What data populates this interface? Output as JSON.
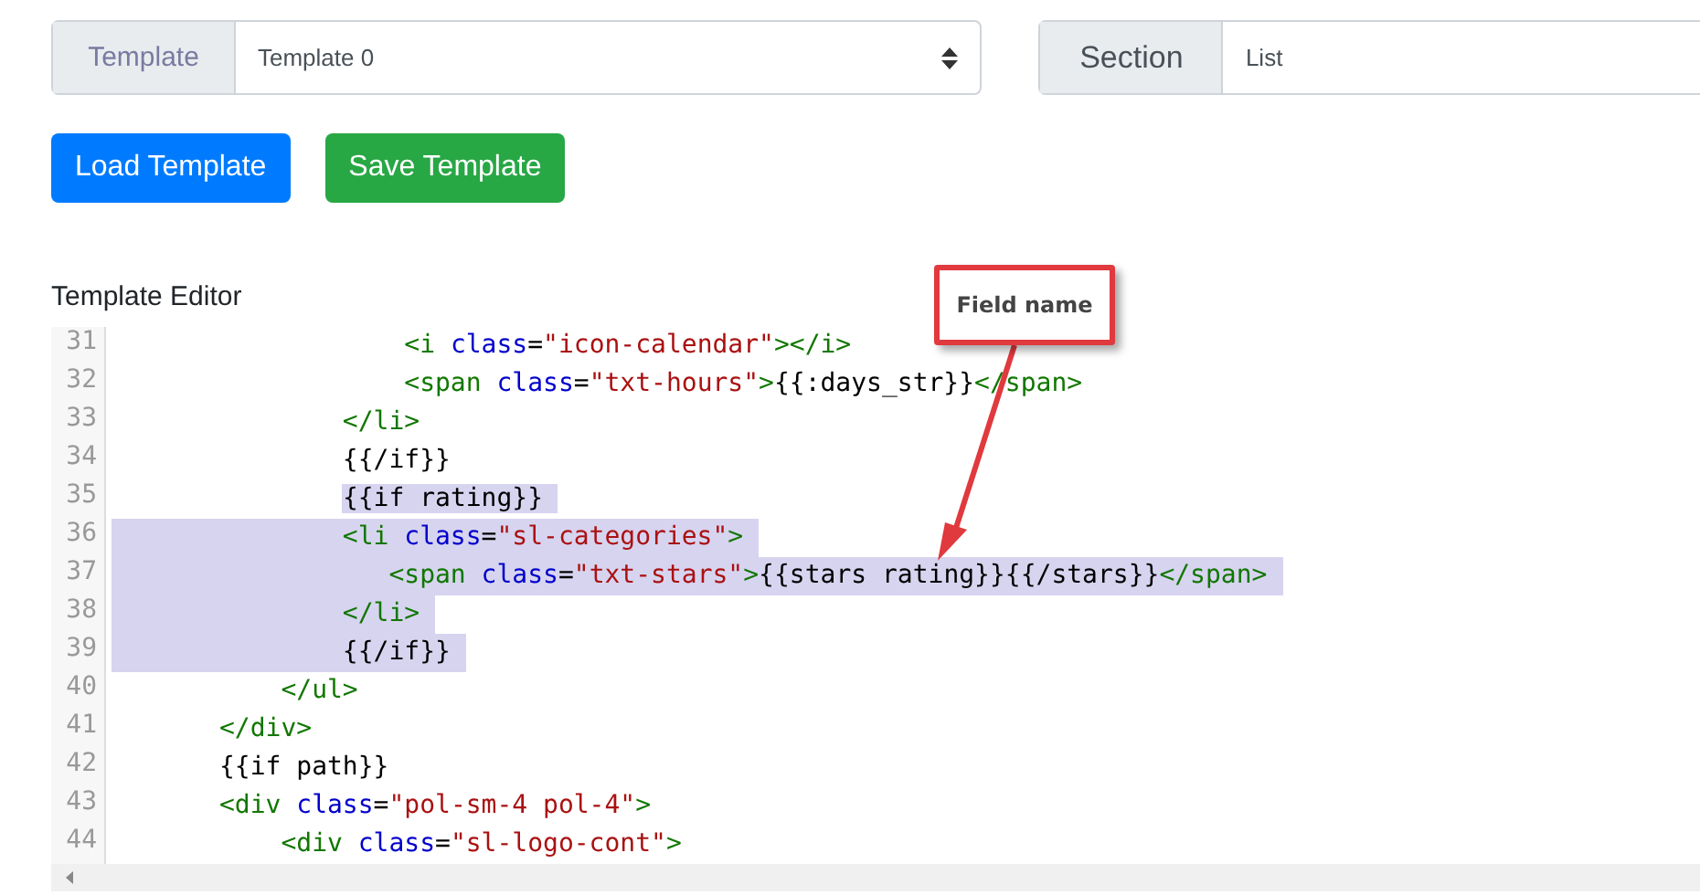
{
  "template_select": {
    "label": "Template",
    "value": "Template 0"
  },
  "section_field": {
    "label": "Section",
    "value": "List"
  },
  "buttons": [
    {
      "label": "Load Template",
      "kind": "primary"
    },
    {
      "label": "Save Template",
      "kind": "success"
    }
  ],
  "editor": {
    "title": "Template Editor",
    "lines": [
      {
        "number": "31",
        "selected": false,
        "tokens": [
          {
            "kind": "tag",
            "text": "                   <i"
          },
          {
            "kind": "attr",
            "text": " class"
          },
          {
            "kind": "plain",
            "text": "="
          },
          {
            "kind": "string",
            "text": "\"icon-calendar\""
          },
          {
            "kind": "tag",
            "text": "></i>"
          }
        ]
      },
      {
        "number": "32",
        "selected": false,
        "tokens": [
          {
            "kind": "tag",
            "text": "                   <span"
          },
          {
            "kind": "attr",
            "text": " class"
          },
          {
            "kind": "plain",
            "text": "="
          },
          {
            "kind": "string",
            "text": "\"txt-hours\""
          },
          {
            "kind": "tag",
            "text": ">"
          },
          {
            "kind": "plain",
            "text": "{{:days_str}}"
          },
          {
            "kind": "tag",
            "text": "</span>"
          }
        ]
      },
      {
        "number": "33",
        "selected": false,
        "tokens": [
          {
            "kind": "tag",
            "text": "               </li>"
          }
        ]
      },
      {
        "number": "34",
        "selected": false,
        "tokens": [
          {
            "kind": "plain",
            "text": "               {{/if}}"
          }
        ]
      },
      {
        "number": "35",
        "selected": true,
        "tokens": [
          {
            "kind": "plain",
            "text": "               {{if rating}}"
          }
        ]
      },
      {
        "number": "36",
        "selected": true,
        "tokens": [
          {
            "kind": "tag",
            "text": "               <li"
          },
          {
            "kind": "attr",
            "text": " class"
          },
          {
            "kind": "plain",
            "text": "="
          },
          {
            "kind": "string",
            "text": "\"sl-categories\""
          },
          {
            "kind": "tag",
            "text": ">"
          }
        ]
      },
      {
        "number": "37",
        "selected": true,
        "tokens": [
          {
            "kind": "tag",
            "text": "                  <span"
          },
          {
            "kind": "attr",
            "text": " class"
          },
          {
            "kind": "plain",
            "text": "="
          },
          {
            "kind": "string",
            "text": "\"txt-stars\""
          },
          {
            "kind": "tag",
            "text": ">"
          },
          {
            "kind": "plain",
            "text": "{{stars rating}}{{/stars}}"
          },
          {
            "kind": "tag",
            "text": "</span>"
          }
        ]
      },
      {
        "number": "38",
        "selected": true,
        "tokens": [
          {
            "kind": "tag",
            "text": "               </li>"
          }
        ]
      },
      {
        "number": "39",
        "selected": true,
        "tokens": [
          {
            "kind": "plain",
            "text": "               {{/if}}"
          }
        ]
      },
      {
        "number": "40",
        "selected": false,
        "tokens": [
          {
            "kind": "tag",
            "text": "           </ul>"
          }
        ]
      },
      {
        "number": "41",
        "selected": false,
        "tokens": [
          {
            "kind": "tag",
            "text": "       </div>"
          }
        ]
      },
      {
        "number": "42",
        "selected": false,
        "tokens": [
          {
            "kind": "plain",
            "text": "       {{if path}}"
          }
        ]
      },
      {
        "number": "43",
        "selected": false,
        "tokens": [
          {
            "kind": "tag",
            "text": "       <div"
          },
          {
            "kind": "attr",
            "text": " class"
          },
          {
            "kind": "plain",
            "text": "="
          },
          {
            "kind": "string",
            "text": "\"pol-sm-4 pol-4\""
          },
          {
            "kind": "tag",
            "text": ">"
          }
        ]
      },
      {
        "number": "44",
        "selected": false,
        "tokens": [
          {
            "kind": "tag",
            "text": "           <div"
          },
          {
            "kind": "attr",
            "text": " class"
          },
          {
            "kind": "plain",
            "text": "="
          },
          {
            "kind": "string",
            "text": "\"sl-logo-cont\""
          },
          {
            "kind": "tag",
            "text": ">"
          }
        ]
      }
    ]
  },
  "callout": {
    "text": "Field name"
  }
}
